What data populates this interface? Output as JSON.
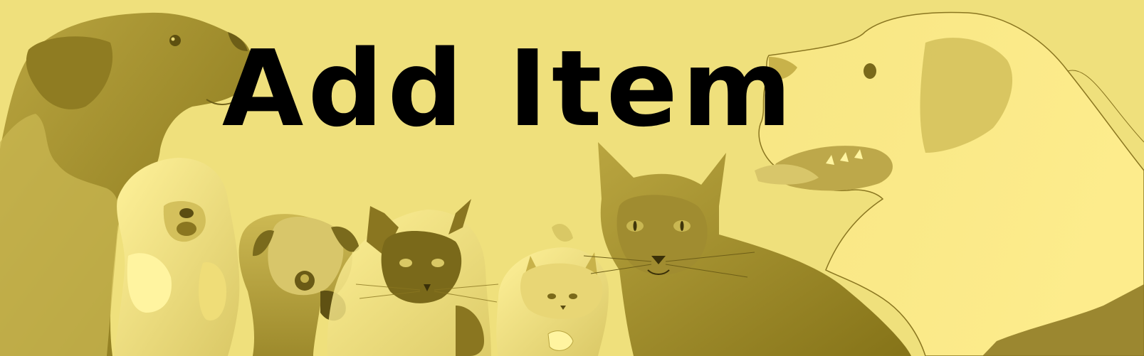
{
  "banner": {
    "title": "Add Item",
    "colors": {
      "background": "#efe07c",
      "light": "#fbeb8e",
      "mid": "#c8b24a",
      "dark": "#8a7620",
      "text": "#000000"
    },
    "artwork": [
      "dog-icon",
      "puppy-icon",
      "kitten-icon",
      "siamese-cat-icon",
      "cat-icon",
      "retriever-icon"
    ]
  }
}
